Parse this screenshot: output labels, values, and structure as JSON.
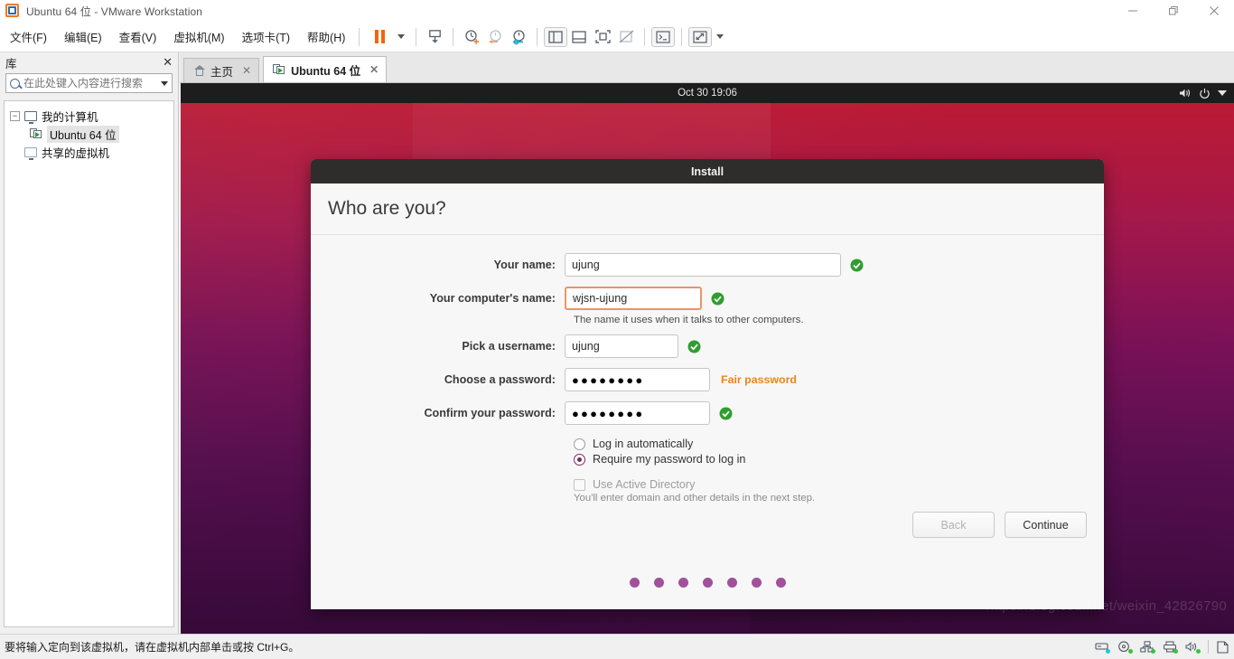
{
  "window": {
    "title": "Ubuntu 64 位 - VMware Workstation",
    "minimize": "—",
    "restore": "❐",
    "close": "✕"
  },
  "menubar": {
    "items": [
      {
        "label": "文件(F)"
      },
      {
        "label": "编辑(E)"
      },
      {
        "label": "查看(V)"
      },
      {
        "label": "虚拟机(M)"
      },
      {
        "label": "选项卡(T)"
      },
      {
        "label": "帮助(H)"
      }
    ],
    "toolbar_icons": [
      "pause-icon",
      "dropdown-caret-icon",
      "snapshot-icon",
      "take-snapshot-icon",
      "revert-snapshot-icon",
      "snapshot-manager-icon",
      "show-library-icon",
      "show-thumbnails-icon",
      "full-screen-icon",
      "unity-mode-icon",
      "console-view-icon",
      "stretch-view-icon",
      "view-dropdown-caret-icon"
    ]
  },
  "sidebar": {
    "title": "库",
    "close_label": "✕",
    "search": {
      "placeholder": "在此处键入内容进行搜索",
      "value": ""
    },
    "tree": [
      {
        "label": "我的计算机",
        "icon": "monitor-icon",
        "expanded": true
      },
      {
        "label": "Ubuntu 64 位",
        "icon": "vm-icon",
        "selected": true
      },
      {
        "label": "共享的虚拟机",
        "icon": "shared-vm-icon"
      }
    ]
  },
  "tabs": [
    {
      "label": "主页",
      "icon": "home-icon",
      "active": false,
      "close": "✕"
    },
    {
      "label": "Ubuntu 64 位",
      "icon": "vm-icon",
      "active": true,
      "close": "✕"
    }
  ],
  "guest": {
    "topbar": {
      "clock": "Oct 30  19:06",
      "icons": [
        "volume-icon",
        "power-icon",
        "system-menu-caret-icon"
      ]
    },
    "installer": {
      "window_title": "Install",
      "heading": "Who are you?",
      "fields": {
        "your_name_label": "Your name:",
        "your_name_value": "ujung",
        "computer_name_label": "Your computer's name:",
        "computer_name_value": "wjsn-ujung",
        "computer_name_hint": "The name it uses when it talks to other computers.",
        "username_label": "Pick a username:",
        "username_value": "ujung",
        "password_label": "Choose a password:",
        "password_value": "●●●●●●●●",
        "password_strength": "Fair password",
        "confirm_label": "Confirm your password:",
        "confirm_value": "●●●●●●●●"
      },
      "options": {
        "auto_login": "Log in automatically",
        "require_password": "Require my password to log in",
        "active_directory": "Use Active Directory",
        "active_directory_hint": "You'll enter domain and other details in the next step.",
        "selected": "require_password"
      },
      "buttons": {
        "back": "Back",
        "continue": "Continue"
      },
      "progress_dots": 7,
      "accent_color": "#a0519a",
      "focus_color": "#e8956a",
      "warn_color": "#e8851d",
      "ok_color": "#2f9e2f"
    }
  },
  "statusbar": {
    "message": "要将输入定向到该虚拟机，请在虚拟机内部单击或按 Ctrl+G。",
    "icons": [
      "hard-disk-icon",
      "cd-dvd-icon",
      "network-icon",
      "printer-icon",
      "sound-icon",
      "usb-icon"
    ]
  },
  "watermark": "https://blog.csdn.net/weixin_42826790"
}
